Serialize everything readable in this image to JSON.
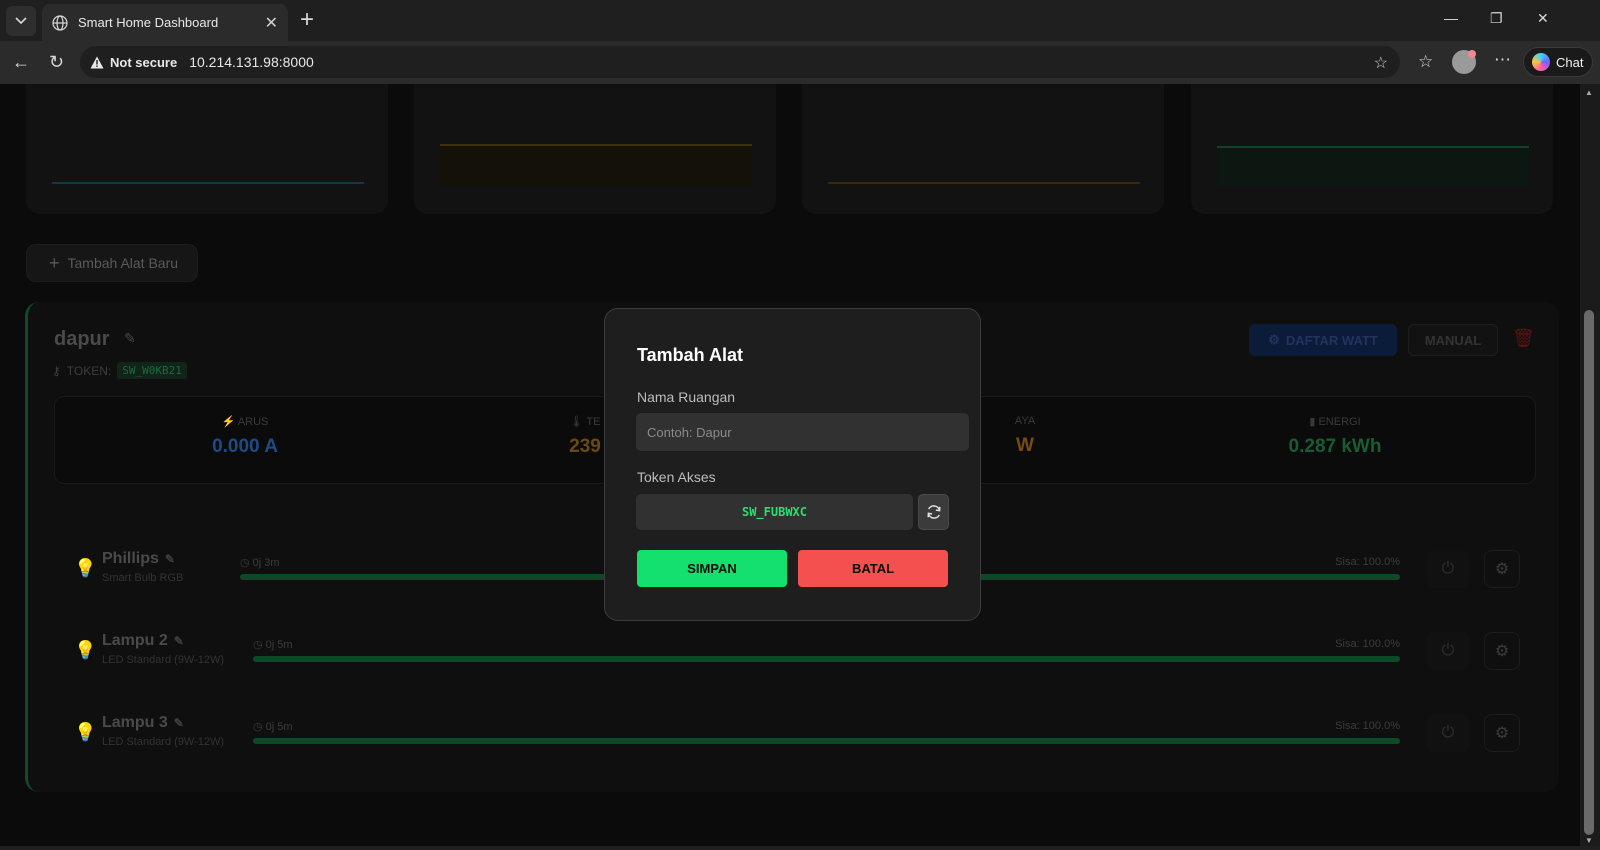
{
  "browser": {
    "tab_title": "Smart Home Dashboard",
    "security_label": "Not secure",
    "url": "10.214.131.98:8000",
    "chat_label": "Chat"
  },
  "page": {
    "add_device_label": "Tambah Alat Baru",
    "room": {
      "name": "dapur",
      "token_label": "TOKEN:",
      "token": "SW_W0KB21",
      "watt_button": "DAFTAR WATT",
      "manual_button": "MANUAL",
      "metrics": [
        {
          "label": "ARUS",
          "value": "0.000 A",
          "color": "#1e4a86"
        },
        {
          "label": "TE",
          "value": "239",
          "color": "#6a4a12"
        },
        {
          "label": "AYA",
          "value": "W",
          "color": "#7a4a14"
        },
        {
          "label": "ENERGI",
          "value": "0.287 kWh",
          "color": "#1a5c32"
        }
      ],
      "devices": [
        {
          "name": "Phillips",
          "type": "Smart Bulb RGB",
          "time": "0j 3m",
          "remaining": "Sisa: 100.0%",
          "progress": 1.0
        },
        {
          "name": "Lampu 2",
          "type": "LED Standard (9W-12W)",
          "time": "0j 5m",
          "remaining": "Sisa: 100.0%",
          "progress": 1.0
        },
        {
          "name": "Lampu 3",
          "type": "LED Standard (9W-12W)",
          "time": "0j 5m",
          "remaining": "Sisa: 100.0%",
          "progress": 1.0
        }
      ]
    }
  },
  "modal": {
    "title": "Tambah Alat",
    "room_name_label": "Nama Ruangan",
    "room_name_placeholder": "Contoh: Dapur",
    "token_label": "Token Akses",
    "token_value": "SW_FUBWXC",
    "save_label": "SIMPAN",
    "cancel_label": "BATAL"
  },
  "colors": {
    "accent_green": "#14e06e",
    "danger_red": "#f4504f"
  }
}
